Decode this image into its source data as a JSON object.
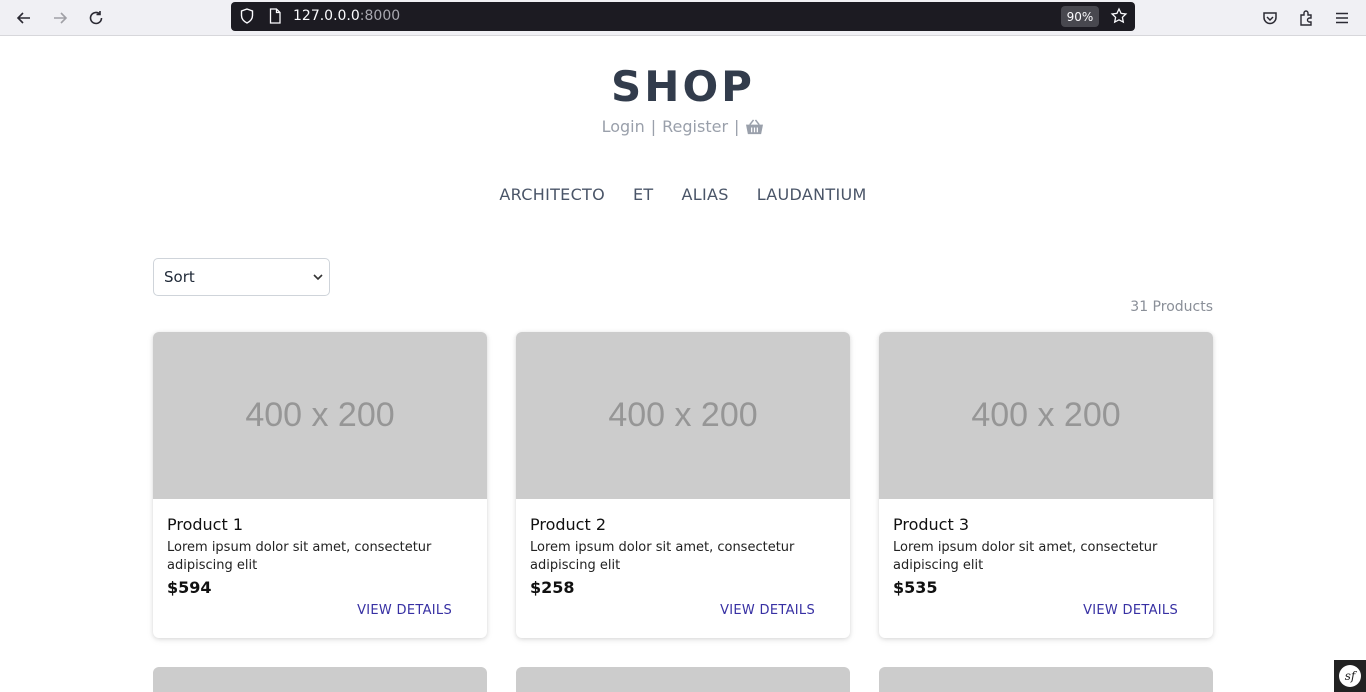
{
  "browser": {
    "url_host": "127.0.0.0",
    "url_port": ":8000",
    "zoom": "90%",
    "icons": [
      "back-icon",
      "forward-icon",
      "reload-icon",
      "shield-icon",
      "page-icon",
      "star-icon",
      "pocket-icon",
      "extensions-icon",
      "menu-icon"
    ]
  },
  "header": {
    "title": "SHOP",
    "login": "Login",
    "separator": "|",
    "register": "Register",
    "cart_icon": "basket-icon"
  },
  "nav": {
    "items": [
      "ARCHITECTO",
      "ET",
      "ALIAS",
      "LAUDANTIUM"
    ]
  },
  "filters": {
    "sort_label": "Sort",
    "product_count": "31 Products"
  },
  "products": [
    {
      "image_text": "400 x 200",
      "name": "Product 1",
      "description": "Lorem ipsum dolor sit amet, consectetur adipiscing elit",
      "price": "$594",
      "link": "VIEW DETAILS"
    },
    {
      "image_text": "400 x 200",
      "name": "Product 2",
      "description": "Lorem ipsum dolor sit amet, consectetur adipiscing elit",
      "price": "$258",
      "link": "VIEW DETAILS"
    },
    {
      "image_text": "400 x 200",
      "name": "Product 3",
      "description": "Lorem ipsum dolor sit amet, consectetur adipiscing elit",
      "price": "$535",
      "link": "VIEW DETAILS"
    }
  ],
  "colors": {
    "title": "#323c4c",
    "link": "#3730a3",
    "placeholder": "#cccccc"
  }
}
